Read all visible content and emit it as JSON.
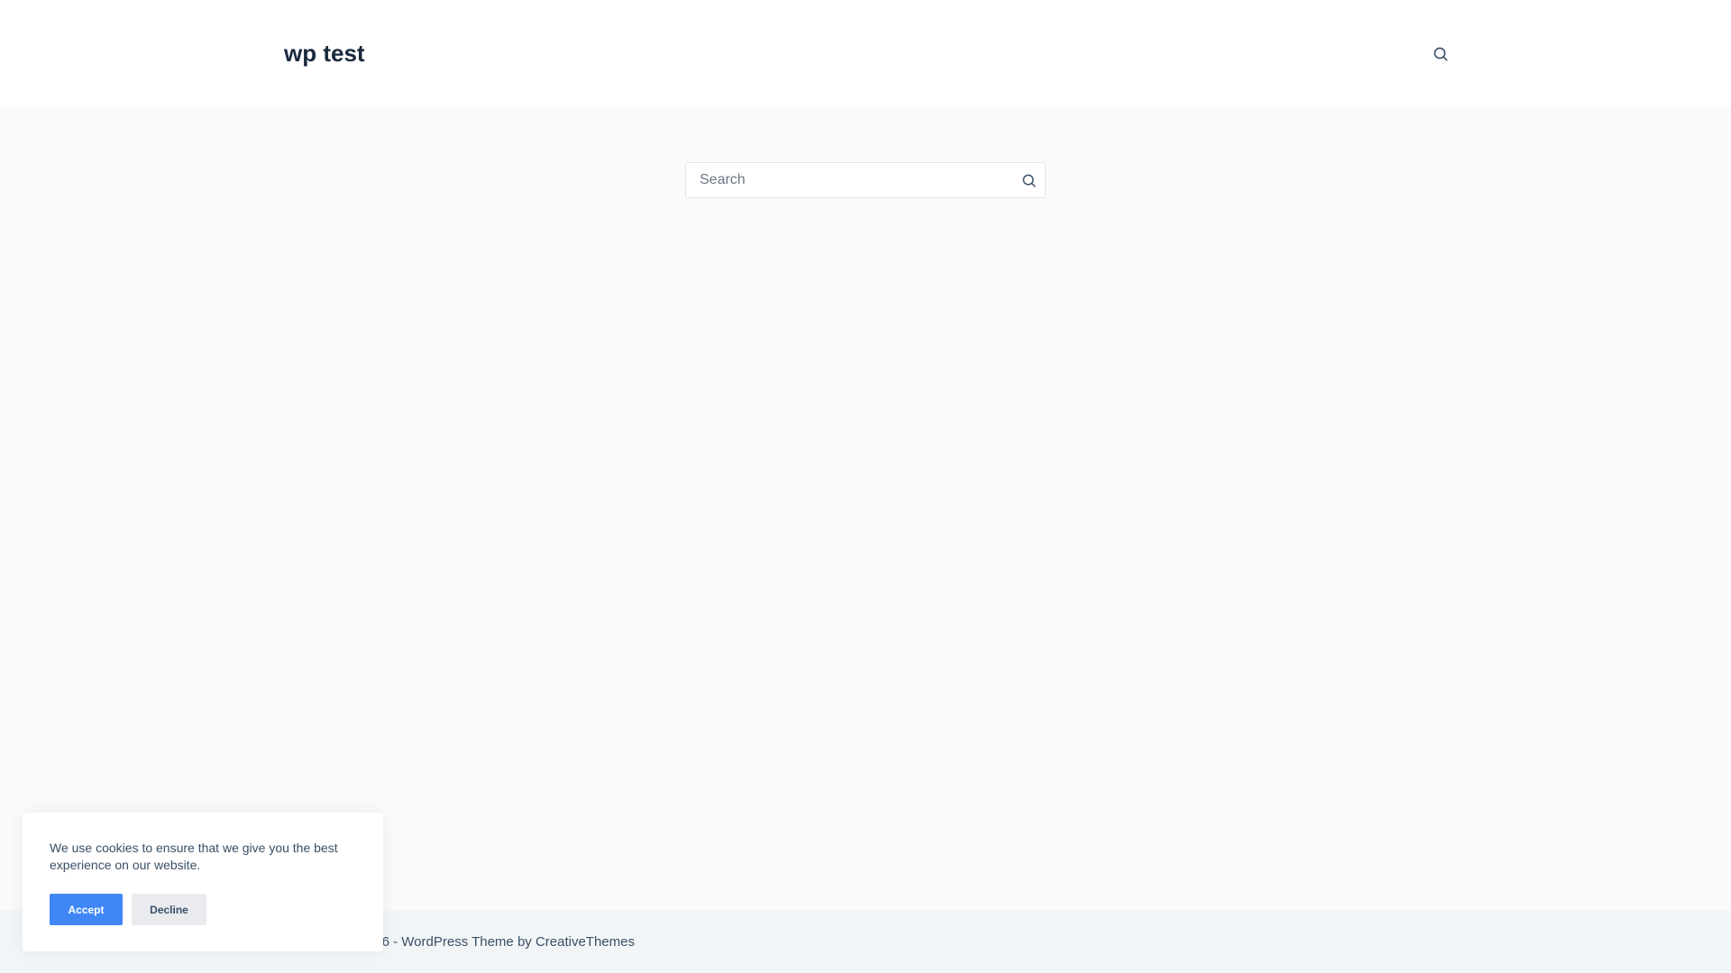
{
  "header": {
    "site_title": "wp test",
    "search_icon": "search-icon"
  },
  "search": {
    "placeholder": "Search",
    "value": "",
    "submit_icon": "search-icon"
  },
  "footer": {
    "copyright": "Copyright © 2026 - WordPress Theme by CreativeThemes"
  },
  "cookie_banner": {
    "message": "We use cookies to ensure that we give you the best experience on our website.",
    "accept_label": "Accept",
    "decline_label": "Decline"
  },
  "colors": {
    "page_background": "#f9fafb",
    "header_background": "#ffffff",
    "footer_background": "#f2f5f7",
    "title_text": "#192a3d",
    "body_text": "#3a4f66",
    "accent": "#3f87f5",
    "decline_background": "#e9ebef"
  }
}
